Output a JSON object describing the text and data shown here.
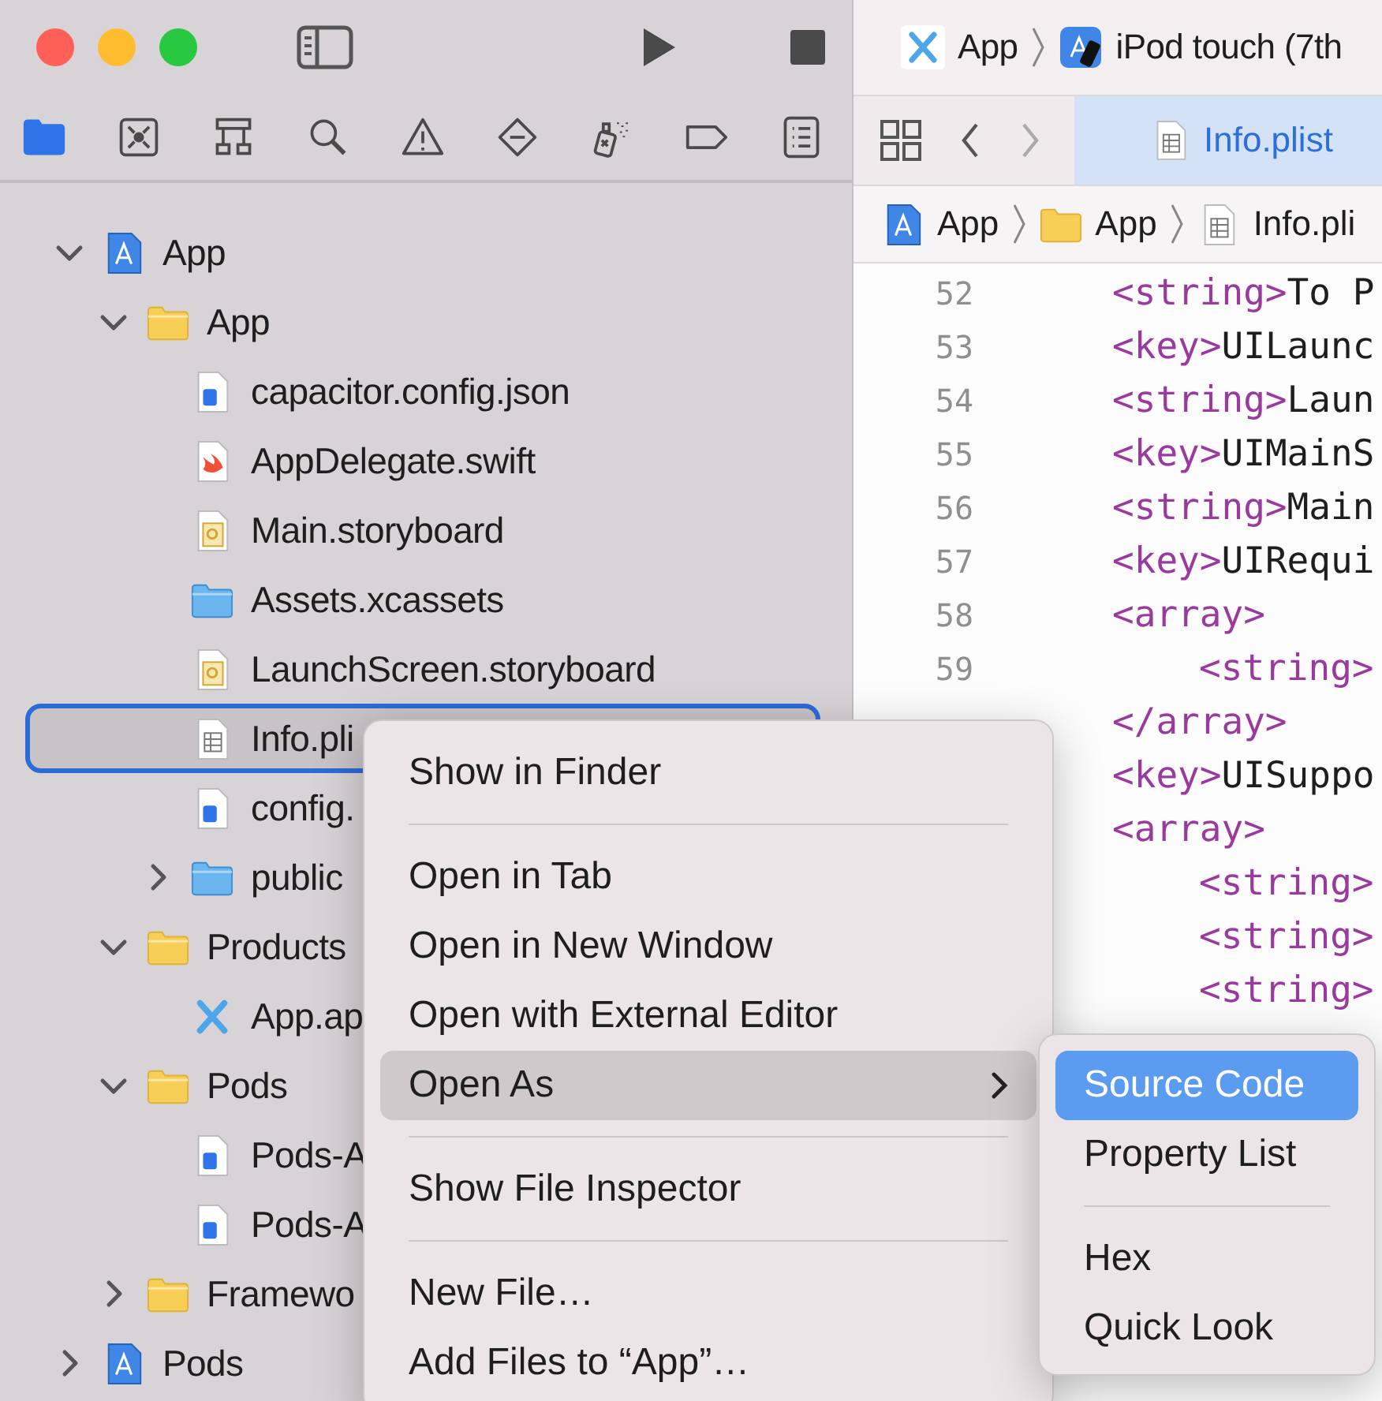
{
  "toolbar": {
    "scheme": "App",
    "device": "iPod touch (7th"
  },
  "navigator_tabs": [
    {
      "kind": "project",
      "selected": true
    },
    {
      "kind": "source-control",
      "selected": false
    },
    {
      "kind": "symbols",
      "selected": false
    },
    {
      "kind": "find",
      "selected": false
    },
    {
      "kind": "issues",
      "selected": false
    },
    {
      "kind": "tests",
      "selected": false
    },
    {
      "kind": "debug",
      "selected": false
    },
    {
      "kind": "breakpoints",
      "selected": false
    },
    {
      "kind": "reports",
      "selected": false
    }
  ],
  "tree": [
    {
      "kind": "project",
      "label": "App",
      "expanded": true,
      "selected": false,
      "children": [
        {
          "kind": "group",
          "label": "App",
          "expanded": true,
          "selected": false,
          "children": [
            {
              "kind": "info",
              "label": "capacitor.config.json",
              "selected": false
            },
            {
              "kind": "swift",
              "label": "AppDelegate.swift",
              "selected": false
            },
            {
              "kind": "storyboard",
              "label": "Main.storyboard",
              "selected": false
            },
            {
              "kind": "assets",
              "label": "Assets.xcassets",
              "selected": false
            },
            {
              "kind": "storyboard",
              "label": "LaunchScreen.storyboard",
              "selected": false
            },
            {
              "kind": "plist",
              "label": "Info.pli",
              "selected": true
            },
            {
              "kind": "info",
              "label": "config.",
              "selected": false
            },
            {
              "kind": "assets",
              "label": "public",
              "expanded": false,
              "selected": false
            }
          ]
        },
        {
          "kind": "group",
          "label": "Products",
          "expanded": true,
          "selected": false,
          "children": [
            {
              "kind": "app",
              "label": "App.ap",
              "selected": false
            }
          ]
        },
        {
          "kind": "group",
          "label": "Pods",
          "expanded": true,
          "selected": false,
          "children": [
            {
              "kind": "info",
              "label": "Pods-A",
              "selected": false
            },
            {
              "kind": "info",
              "label": "Pods-A",
              "selected": false
            }
          ]
        },
        {
          "kind": "group",
          "label": "Framewo",
          "expanded": false,
          "selected": false
        }
      ]
    },
    {
      "kind": "project",
      "label": "Pods",
      "expanded": false,
      "selected": false
    }
  ],
  "editor": {
    "tab": {
      "label": "Info.plist",
      "selected": true
    },
    "breadcrumb": [
      {
        "kind": "project",
        "label": "App"
      },
      {
        "kind": "group",
        "label": "App"
      },
      {
        "kind": "plist",
        "label": "Info.pli"
      }
    ],
    "lines": [
      {
        "number": "52",
        "tokens": [
          {
            "kind": "tag",
            "text": "<string>"
          },
          {
            "kind": "text",
            "text": "To P"
          }
        ]
      },
      {
        "number": "53",
        "tokens": [
          {
            "kind": "tag",
            "text": "<key>"
          },
          {
            "kind": "text",
            "text": "UILaunc"
          }
        ]
      },
      {
        "number": "54",
        "tokens": [
          {
            "kind": "tag",
            "text": "<string>"
          },
          {
            "kind": "text",
            "text": "Laun"
          }
        ]
      },
      {
        "number": "55",
        "tokens": [
          {
            "kind": "tag",
            "text": "<key>"
          },
          {
            "kind": "text",
            "text": "UIMainS"
          }
        ]
      },
      {
        "number": "56",
        "tokens": [
          {
            "kind": "tag",
            "text": "<string>"
          },
          {
            "kind": "text",
            "text": "Main"
          }
        ]
      },
      {
        "number": "57",
        "tokens": [
          {
            "kind": "tag",
            "text": "<key>"
          },
          {
            "kind": "text",
            "text": "UIRequi"
          }
        ]
      },
      {
        "number": "58",
        "tokens": [
          {
            "kind": "tag",
            "text": "<array>"
          }
        ]
      },
      {
        "number": "59",
        "indented": true,
        "tokens": [
          {
            "kind": "tag",
            "text": "<string>"
          }
        ]
      },
      {
        "tokens": [
          {
            "kind": "tag",
            "text": "</array>"
          }
        ]
      },
      {
        "tokens": [
          {
            "kind": "tag",
            "text": "<key>"
          },
          {
            "kind": "text",
            "text": "UISuppo"
          }
        ]
      },
      {
        "tokens": [
          {
            "kind": "tag",
            "text": "<array>"
          }
        ]
      },
      {
        "indented": true,
        "tokens": [
          {
            "kind": "tag",
            "text": "<string>"
          }
        ]
      },
      {
        "indented": true,
        "tokens": [
          {
            "kind": "tag",
            "text": "<string>"
          }
        ]
      },
      {
        "indented": true,
        "tokens": [
          {
            "kind": "tag",
            "text": "<string>"
          }
        ]
      }
    ]
  },
  "context_menu": {
    "items": [
      {
        "kind": "item",
        "label": "Show in Finder",
        "selected": false
      },
      {
        "kind": "separator"
      },
      {
        "kind": "item",
        "label": "Open in Tab",
        "selected": false
      },
      {
        "kind": "item",
        "label": "Open in New Window",
        "selected": false
      },
      {
        "kind": "item",
        "label": "Open with External Editor",
        "selected": false
      },
      {
        "kind": "item",
        "label": "Open As",
        "selected": true,
        "submenu": true
      },
      {
        "kind": "separator"
      },
      {
        "kind": "item",
        "label": "Show File Inspector",
        "selected": false
      },
      {
        "kind": "separator"
      },
      {
        "kind": "item",
        "label": "New File…",
        "selected": false
      },
      {
        "kind": "item",
        "label": "Add Files to “App”…",
        "selected": false
      }
    ]
  },
  "submenu": {
    "items": [
      {
        "kind": "item",
        "label": "Source Code",
        "selected": true
      },
      {
        "kind": "item",
        "label": "Property List",
        "selected": false
      },
      {
        "kind": "separator"
      },
      {
        "kind": "item",
        "label": "Hex",
        "selected": false
      },
      {
        "kind": "item",
        "label": "Quick Look",
        "selected": false
      }
    ]
  }
}
